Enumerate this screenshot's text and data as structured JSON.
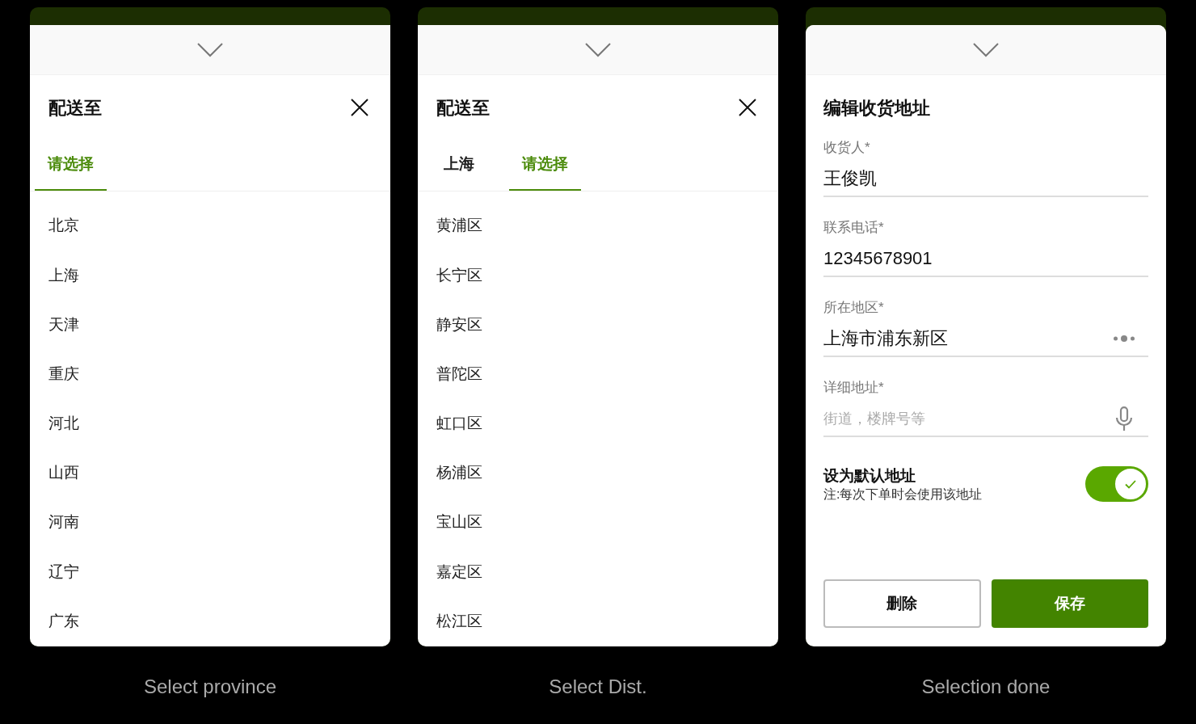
{
  "screens": [
    {
      "kind": "picker",
      "title": "配送至",
      "tabs": [
        {
          "label": "请选择",
          "selected": true
        }
      ],
      "options": [
        "北京",
        "上海",
        "天津",
        "重庆",
        "河北",
        "山西",
        "河南",
        "辽宁",
        "广东"
      ],
      "caption": "Select province"
    },
    {
      "kind": "picker",
      "title": "配送至",
      "tabs": [
        {
          "label": "上海",
          "selected": false
        },
        {
          "label": "请选择",
          "selected": true
        }
      ],
      "options": [
        "黄浦区",
        "长宁区",
        "静安区",
        "普陀区",
        "虹口区",
        "杨浦区",
        "宝山区",
        "嘉定区",
        "松江区"
      ],
      "caption": "Select Dist."
    },
    {
      "kind": "form",
      "title": "编辑收货地址",
      "fields": [
        {
          "kind": "text",
          "label": "收货人*",
          "value": "王俊凯"
        },
        {
          "kind": "text",
          "label": "联系电话*",
          "value": "12345678901"
        },
        {
          "kind": "select",
          "label": "所在地区*",
          "value": "上海市浦东新区"
        },
        {
          "kind": "voice",
          "label": "详细地址*",
          "placeholder": "街道，楼牌号等"
        }
      ],
      "default_toggle": {
        "label": "设为默认地址",
        "note": "注:每次下单时会使用该地址",
        "on": true
      },
      "buttons": [
        {
          "kind": "secondary",
          "label": "删除"
        },
        {
          "kind": "primary",
          "label": "保存"
        }
      ],
      "caption": "Selection done"
    }
  ]
}
